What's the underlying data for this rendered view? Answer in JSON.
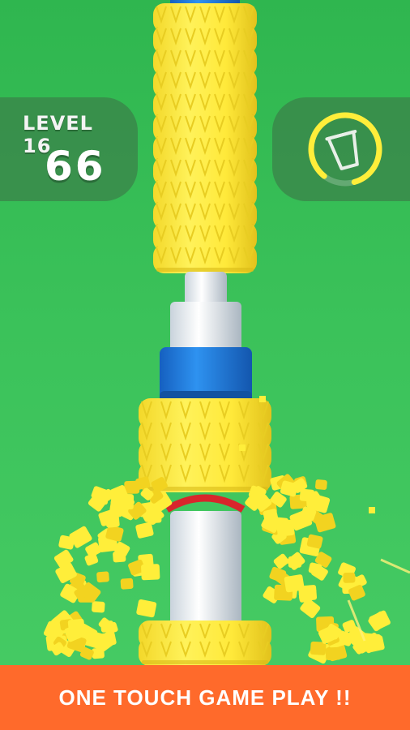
{
  "hud": {
    "level_label": "LEVEL 16",
    "score": "66",
    "cup_icon": "cup-icon",
    "cup_progress": 0.85
  },
  "banner": {
    "text": "ONE TOUCH GAME PLAY !!"
  },
  "colors": {
    "background": "#3bc25a",
    "corn": "#ffee3a",
    "ring": "#1e7fe0",
    "banner": "#ff6a2b"
  }
}
